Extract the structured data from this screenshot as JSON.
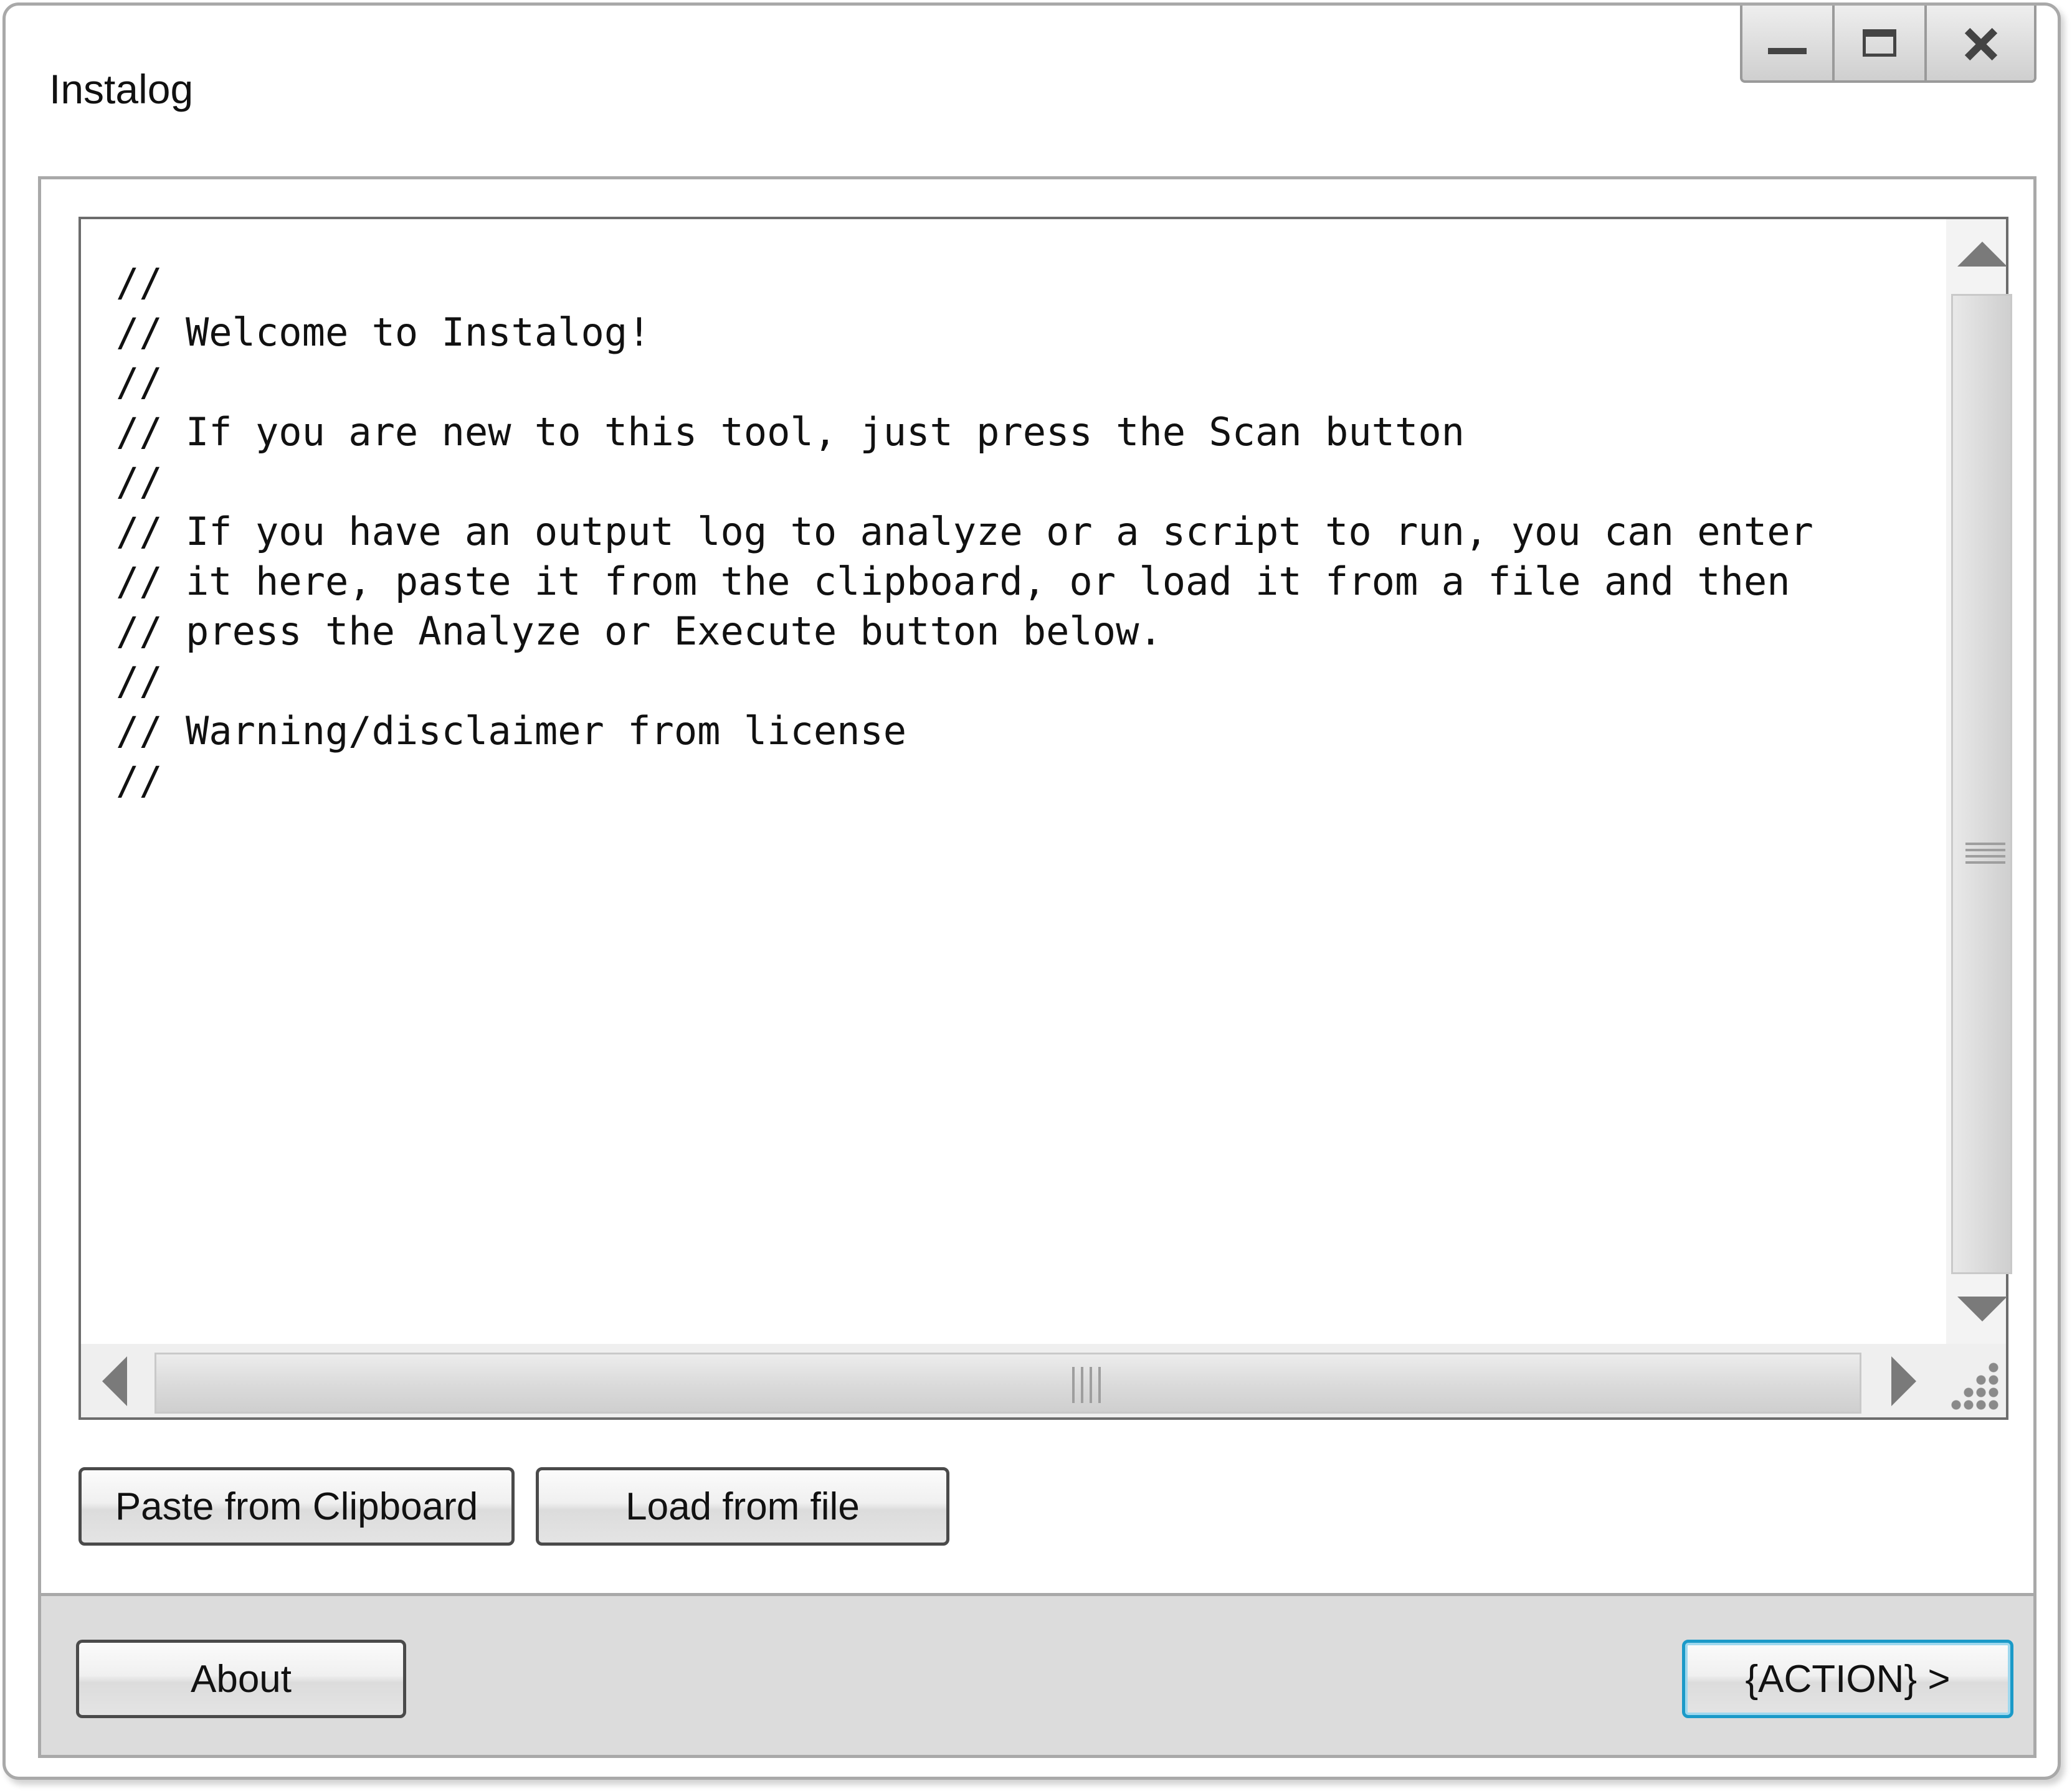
{
  "window": {
    "title": "Instalog"
  },
  "caption_buttons": {
    "minimize": "minimize-icon",
    "maximize": "maximize-icon",
    "close": "close-icon"
  },
  "editor": {
    "content": "//\n// Welcome to Instalog!\n//\n// If you are new to this tool, just press the Scan button\n//\n// If you have an output log to analyze or a script to run, you can enter\n// it here, paste it from the clipboard, or load it from a file and then\n// press the Analyze or Execute button below.\n//\n// Warning/disclaimer from license\n//"
  },
  "input_actions": {
    "paste_label": "Paste from Clipboard",
    "load_label": "Load from file"
  },
  "footer": {
    "about_label": "About",
    "action_label": "{ACTION} >"
  },
  "colors": {
    "frame_border": "#a9a9a9",
    "footer_bg": "#dcdcdc",
    "action_focus": "#1b9ac8"
  }
}
